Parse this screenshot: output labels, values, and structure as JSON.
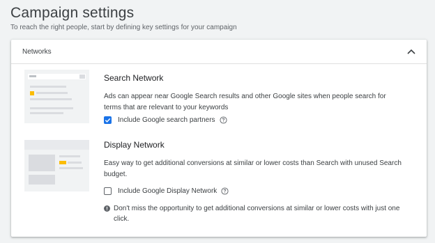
{
  "page": {
    "title": "Campaign settings",
    "subtitle": "To reach the right people, start by defining key settings for your campaign"
  },
  "networks_card": {
    "header": "Networks",
    "search_network": {
      "title": "Search Network",
      "description": "Ads can appear near Google Search results and other Google sites when people search for terms that are relevant to your keywords",
      "option_label": "Include Google search partners",
      "option_checked": true
    },
    "display_network": {
      "title": "Display Network",
      "description": "Easy way to get additional conversions at similar or lower costs than Search with unused Search budget.",
      "option_label": "Include Google Display Network",
      "option_checked": false,
      "notice": "Don't miss the opportunity to get additional conversions at similar or lower costs with just one click."
    }
  },
  "colors": {
    "accent": "#1a73e8",
    "highlight": "#fbbc04",
    "thumb_bg": "#f1f3f4",
    "thumb_bar": "#dadce0"
  },
  "icons": {
    "collapse": "chevron-up-icon",
    "help": "help-circle-icon",
    "notice": "info-filled-icon"
  }
}
